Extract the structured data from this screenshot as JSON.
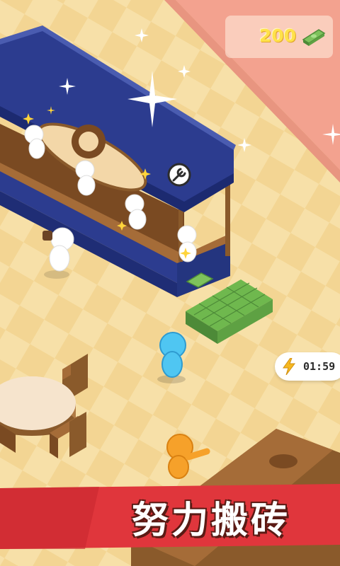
{
  "hud": {
    "money": "200",
    "timer": "01:59",
    "timer_icon": "lightning-icon"
  },
  "banner": {
    "text": "努力搬砖"
  },
  "shop": {
    "tool_icon": "wrench-icon"
  },
  "colors": {
    "floor": "#f3d593",
    "floor_tile": "#f7e0a8",
    "pink_wall": "#f3a28f",
    "awning": "#2c3c8f",
    "counter": "#8a5a2b",
    "cash": "#8fd06b",
    "player": "#4fc6f2",
    "helper": "#f6a12a",
    "banner": "#e0363c"
  }
}
